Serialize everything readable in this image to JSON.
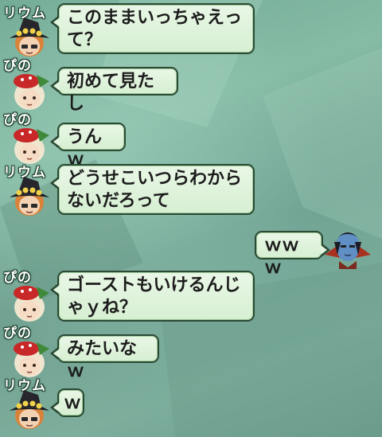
{
  "chat": {
    "messages": [
      {
        "speaker": "リウム",
        "avatar": "witch-hat-avatar-icon",
        "side": "left",
        "text": "このままいっちゃえっ\nて？"
      },
      {
        "speaker": "ぴの",
        "avatar": "red-beret-avatar-icon",
        "side": "left",
        "text": "初めて見たし"
      },
      {
        "speaker": "ぴの",
        "avatar": "red-beret-avatar-icon",
        "side": "left",
        "text": "うんｗ"
      },
      {
        "speaker": "リウム",
        "avatar": "witch-hat-avatar-icon",
        "side": "left",
        "text": "どうせこいつらわから\nないだろって"
      },
      {
        "speaker": "",
        "avatar": "blue-demon-avatar-icon",
        "side": "right",
        "text": "ｗｗｗ"
      },
      {
        "speaker": "ぴの",
        "avatar": "red-beret-avatar-icon",
        "side": "left",
        "text": "ゴーストもいけるんじ\nゃｙね？"
      },
      {
        "speaker": "ぴの",
        "avatar": "red-beret-avatar-icon",
        "side": "left",
        "text": "みたいなｗ"
      },
      {
        "speaker": "リウム",
        "avatar": "witch-hat-avatar-icon",
        "side": "left",
        "text": "ｗ"
      }
    ]
  },
  "colors": {
    "bubble_fill": "#e3f4df",
    "bubble_border": "#2b4a34",
    "background": "#7eae9c"
  }
}
